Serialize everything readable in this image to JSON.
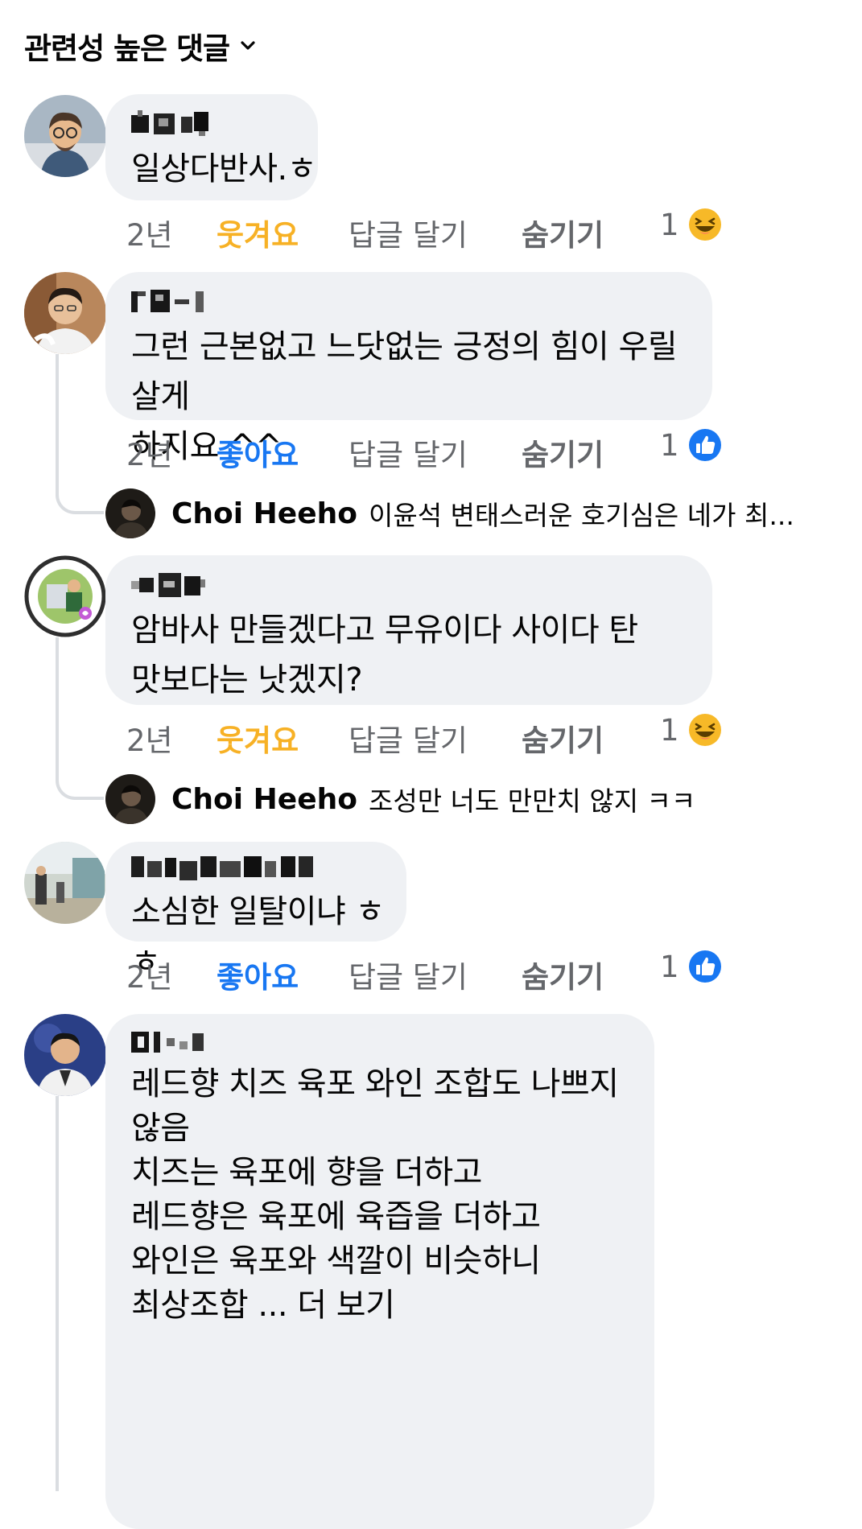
{
  "header": {
    "title": "관련성 높은 댓글",
    "chevron_icon": "chevron-down-icon"
  },
  "colors": {
    "haha": "#f7b125",
    "like": "#1877f2",
    "bubble": "#eff1f4",
    "muted": "#65676b"
  },
  "comments": [
    {
      "text": "일상다반사.ㅎ",
      "time": "2년",
      "reaction_label": "웃겨요",
      "reply_label": "답글 달기",
      "hide_label": "숨기기",
      "reaction_count": "1",
      "reaction_icon": "haha-emoji-icon"
    },
    {
      "text": "그런 근본없고 느닷없는 긍정의 힘이 우릴 살게\n하지요 ^^",
      "time": "2년",
      "reaction_label": "좋아요",
      "reply_label": "답글 달기",
      "hide_label": "숨기기",
      "reaction_count": "1",
      "reaction_icon": "like-thumb-icon",
      "reply": {
        "name": "Choi Heeho",
        "text": "이윤석 변태스러운 호기심은 네가 최..."
      }
    },
    {
      "text": "암바사 만들겠다고 무유이다 사이다 탄\n맛보다는 낫겠지?",
      "time": "2년",
      "reaction_label": "웃겨요",
      "reply_label": "답글 달기",
      "hide_label": "숨기기",
      "reaction_count": "1",
      "reaction_icon": "haha-emoji-icon",
      "reply": {
        "name": "Choi Heeho",
        "text": "조성만 너도 만만치 않지 ㅋㅋ"
      }
    },
    {
      "text": "소심한 일탈이냐 ㅎㅎ",
      "time": "2년",
      "reaction_label": "좋아요",
      "reply_label": "답글 달기",
      "hide_label": "숨기기",
      "reaction_count": "1",
      "reaction_icon": "like-thumb-icon"
    },
    {
      "text": "레드향 치즈 육포 와인 조합도 나쁘지 않음\n치즈는 육포에 향을 더하고\n레드향은 육포에 육즙을 더하고\n와인은 육포와 색깔이 비슷하니\n최상조합 ... 더 보기"
    }
  ]
}
